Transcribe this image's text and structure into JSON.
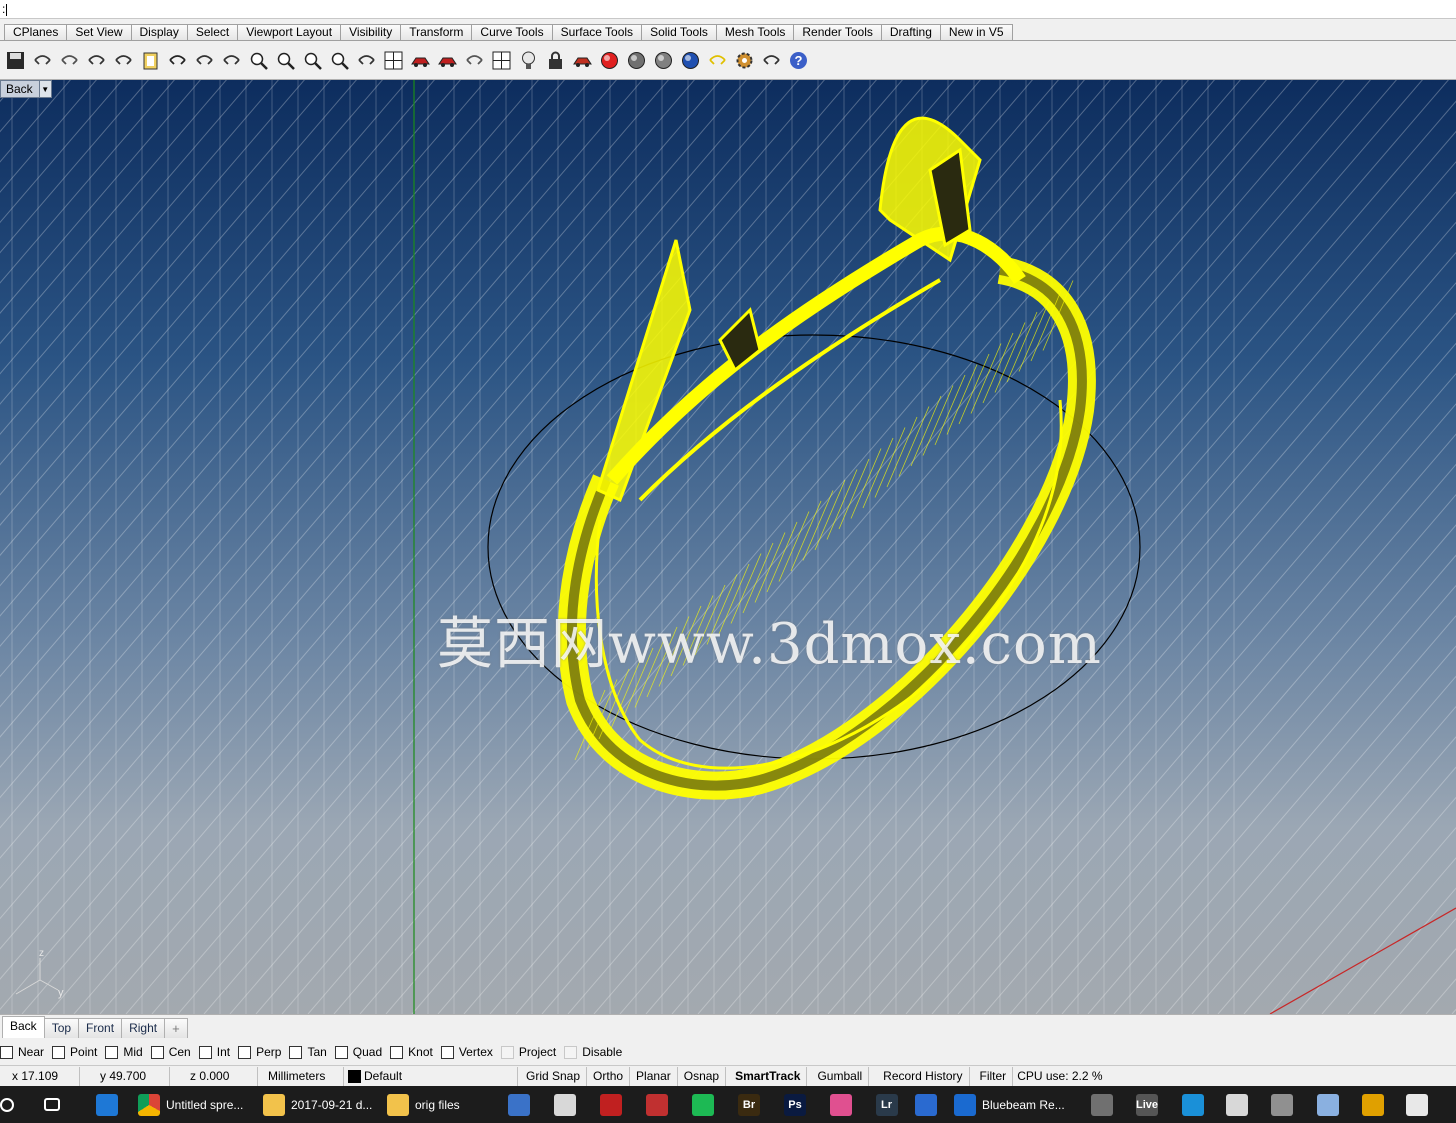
{
  "command_line": {
    "text": ":"
  },
  "ribbon_tabs": [
    "CPlanes",
    "Set View",
    "Display",
    "Select",
    "Viewport Layout",
    "Visibility",
    "Transform",
    "Curve Tools",
    "Surface Tools",
    "Solid Tools",
    "Mesh Tools",
    "Render Tools",
    "Drafting",
    "New in V5"
  ],
  "toolbar_icons": [
    "save-icon",
    "print-icon",
    "import-icon",
    "cut-icon",
    "copy-icon",
    "paste-icon",
    "undo-icon",
    "pan-icon",
    "rotate-view-icon",
    "zoom-window-icon",
    "zoom-dynamic-icon",
    "zoom-extents-icon",
    "zoom-selected-icon",
    "undo-view-icon",
    "four-viewports-icon",
    "car-icon",
    "rotate-car-icon",
    "cplane-icon",
    "snap-grid-icon",
    "lightbulb-icon",
    "lock-icon",
    "layer-icon",
    "color-wheel-icon",
    "shaded-sphere-icon",
    "rendered-sphere-icon",
    "blue-sphere-icon",
    "pencil-tool-icon",
    "settings-gear-icon",
    "grid-options-icon",
    "help-icon"
  ],
  "viewport": {
    "title": "Back",
    "watermark": "莫西网www.3dmox.com",
    "axis_labels": {
      "z": "z",
      "y": "y"
    },
    "colors": {
      "wireframe": "#ffff00",
      "grid": "#ffffff",
      "y_axis": "#1a8c1a",
      "x_axis": "#c82828",
      "curve": "#000000"
    }
  },
  "viewport_tabs": [
    "Back",
    "Top",
    "Front",
    "Right"
  ],
  "viewport_tab_add": "+",
  "osnaps": [
    "Near",
    "Point",
    "Mid",
    "Cen",
    "Int",
    "Perp",
    "Tan",
    "Quad",
    "Knot",
    "Vertex",
    "Project",
    "Disable"
  ],
  "status": {
    "x": "x 17.109",
    "y": "y 49.700",
    "z": "z 0.000",
    "units": "Millimeters",
    "layer": "Default",
    "grid_snap": "Grid Snap",
    "ortho": "Ortho",
    "planar": "Planar",
    "osnap": "Osnap",
    "smarttrack": "SmartTrack",
    "gumball": "Gumball",
    "record_history": "Record History",
    "filter": "Filter",
    "cpu": "CPU use: 2.2 %"
  },
  "taskbar": {
    "items": [
      {
        "label": "Untitled spre...",
        "icon": "chrome-icon"
      },
      {
        "label": "2017-09-21 d...",
        "icon": "folder-icon"
      },
      {
        "label": "orig files",
        "icon": "folder-icon"
      },
      {
        "label": "Bluebeam Re...",
        "icon": "bluebeam-icon"
      }
    ],
    "app_icons": [
      "store-icon",
      "paint-icon",
      "app-icon",
      "books-icon",
      "spotify-icon",
      "bridge-icon",
      "photoshop-icon",
      "color-app-icon",
      "lightroom-icon",
      "sync-icon",
      "network-icon",
      "live-icon",
      "cortana-icon",
      "sheet-icon",
      "pc-icon",
      "snowflake-icon",
      "plex-icon",
      "mail-icon"
    ],
    "icon_labels": {
      "bridge": "Br",
      "photoshop": "Ps",
      "lightroom": "Lr",
      "live": "Live"
    }
  }
}
